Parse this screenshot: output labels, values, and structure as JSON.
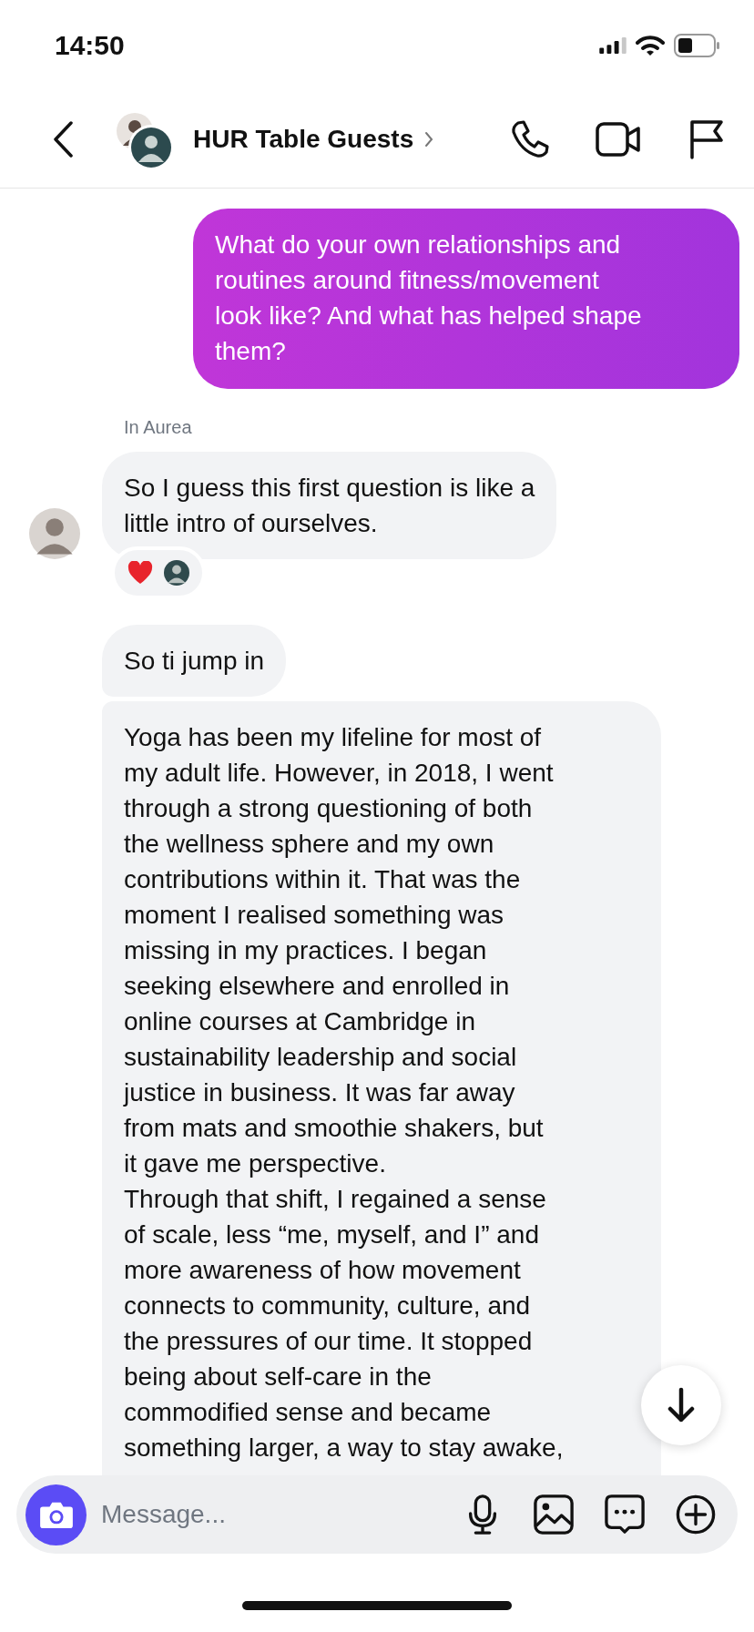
{
  "status_bar": {
    "time": "14:50"
  },
  "header": {
    "title": "HUR Table Guests"
  },
  "messages": [
    {
      "kind": "sent",
      "text": "What do your own relationships and\nroutines around fitness/movement\nlook like? And what has helped shape\nthem?"
    },
    {
      "kind": "sender_label",
      "text": "In Aurea"
    },
    {
      "kind": "received",
      "text": "So I guess this first question is like a\nlittle intro of ourselves.",
      "show_avatar": true,
      "reacted": true
    },
    {
      "kind": "received",
      "text": "So ti jump in",
      "show_avatar": false,
      "reacted": false
    },
    {
      "kind": "received_long",
      "paragraphs": [
        "Yoga has been my lifeline for most of\nmy adult life. However, in 2018, I went\nthrough a strong questioning of both\nthe wellness sphere and my own\ncontributions within it. That was the\nmoment I realised something was\nmissing in my practices. I began\nseeking elsewhere and enrolled in\nonline courses at Cambridge in\nsustainability leadership and social\njustice in business. It was far away\nfrom mats and smoothie shakers, but\nit gave me perspective.",
        "Through that shift, I regained a sense\nof scale, less “me, myself, and I” and\nmore awareness of how movement\nconnects to community, culture, and\nthe pressures of our time. It stopped\nbeing about self-care in the\ncommodified sense and became\nsomething larger, a way to stay awake,"
      ]
    }
  ],
  "composer": {
    "placeholder": "Message..."
  }
}
